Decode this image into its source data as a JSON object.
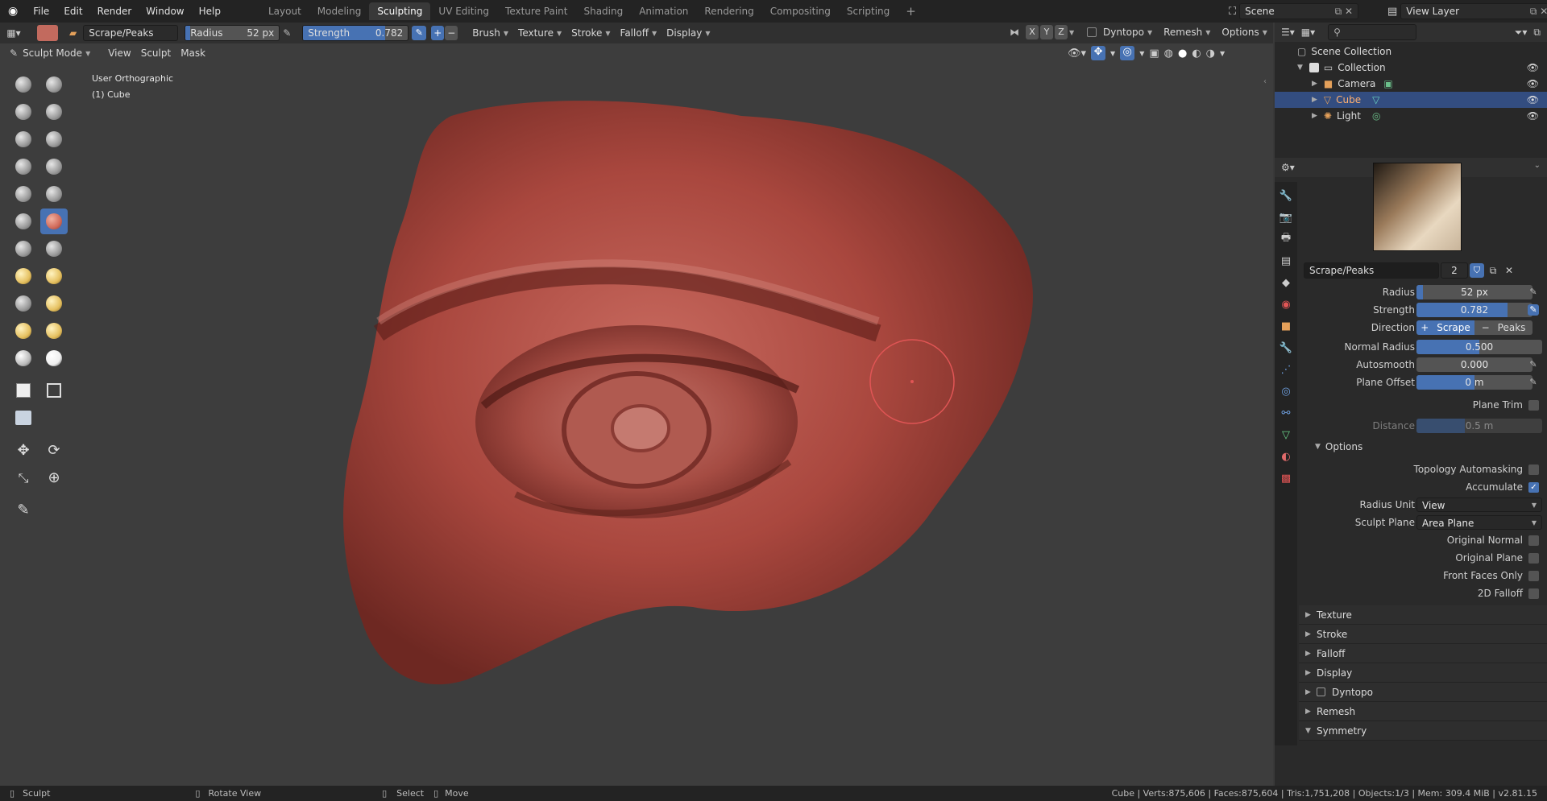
{
  "menu": {
    "items": [
      "File",
      "Edit",
      "Render",
      "Window",
      "Help"
    ]
  },
  "workspaces": {
    "tabs": [
      "Layout",
      "Modeling",
      "Sculpting",
      "UV Editing",
      "Texture Paint",
      "Shading",
      "Animation",
      "Rendering",
      "Compositing",
      "Scripting"
    ],
    "active": "Sculpting",
    "add": "+"
  },
  "scene": {
    "name": "Scene",
    "view_layer": "View Layer"
  },
  "tool_header": {
    "brush_name": "Scrape/Peaks",
    "radius_label": "Radius",
    "radius_value": "52 px",
    "strength_label": "Strength",
    "strength_value": "0.782",
    "strength_fraction": 0.782,
    "menus": [
      "Brush",
      "Texture",
      "Stroke",
      "Falloff",
      "Display"
    ],
    "axes": [
      "X",
      "Y",
      "Z"
    ],
    "dyntopo": "Dyntopo",
    "remesh": "Remesh",
    "options": "Options"
  },
  "viewport_header": {
    "mode": "Sculpt Mode",
    "menus": [
      "View",
      "Sculpt",
      "Mask"
    ]
  },
  "viewport": {
    "projection": "User Orthographic",
    "object": "(1) Cube"
  },
  "outliner": {
    "root": "Scene Collection",
    "collection": "Collection",
    "objects": [
      "Camera",
      "Cube",
      "Light"
    ],
    "selected": "Cube"
  },
  "properties": {
    "brush_name": "Scrape/Peaks",
    "users": "2",
    "radius": {
      "label": "Radius",
      "value": "52 px"
    },
    "strength": {
      "label": "Strength",
      "value": "0.782",
      "fraction": 0.782
    },
    "direction": {
      "label": "Direction",
      "opt1": "Scrape",
      "opt2": "Peaks",
      "opt1_sign": "+",
      "opt2_sign": "−"
    },
    "normal_radius": {
      "label": "Normal Radius",
      "value": "0.500",
      "fraction": 0.5
    },
    "autosmooth": {
      "label": "Autosmooth",
      "value": "0.000"
    },
    "plane_offset": {
      "label": "Plane Offset",
      "value": "0 m"
    },
    "plane_trim": "Plane Trim",
    "distance": {
      "label": "Distance",
      "value": "0.5 m"
    },
    "options_header": "Options",
    "topology_automasking": "Topology Automasking",
    "accumulate": "Accumulate",
    "radius_unit": {
      "label": "Radius Unit",
      "value": "View"
    },
    "sculpt_plane": {
      "label": "Sculpt Plane",
      "value": "Area Plane"
    },
    "original_normal": "Original Normal",
    "original_plane": "Original Plane",
    "front_faces_only": "Front Faces Only",
    "falloff_2d": "2D Falloff",
    "sections": [
      "Texture",
      "Stroke",
      "Falloff",
      "Display",
      "Dyntopo",
      "Remesh",
      "Symmetry"
    ]
  },
  "status": {
    "sculpt": "Sculpt",
    "rotate": "Rotate View",
    "select": "Select",
    "move": "Move",
    "stats": "Cube | Verts:875,606 | Faces:875,604 | Tris:1,751,208 | Objects:1/3 | Mem: 309.4 MiB | v2.81.15"
  },
  "colors": {
    "accent": "#4772b3",
    "mesh": "#b5544a",
    "brush_cursor": "#e05555"
  }
}
